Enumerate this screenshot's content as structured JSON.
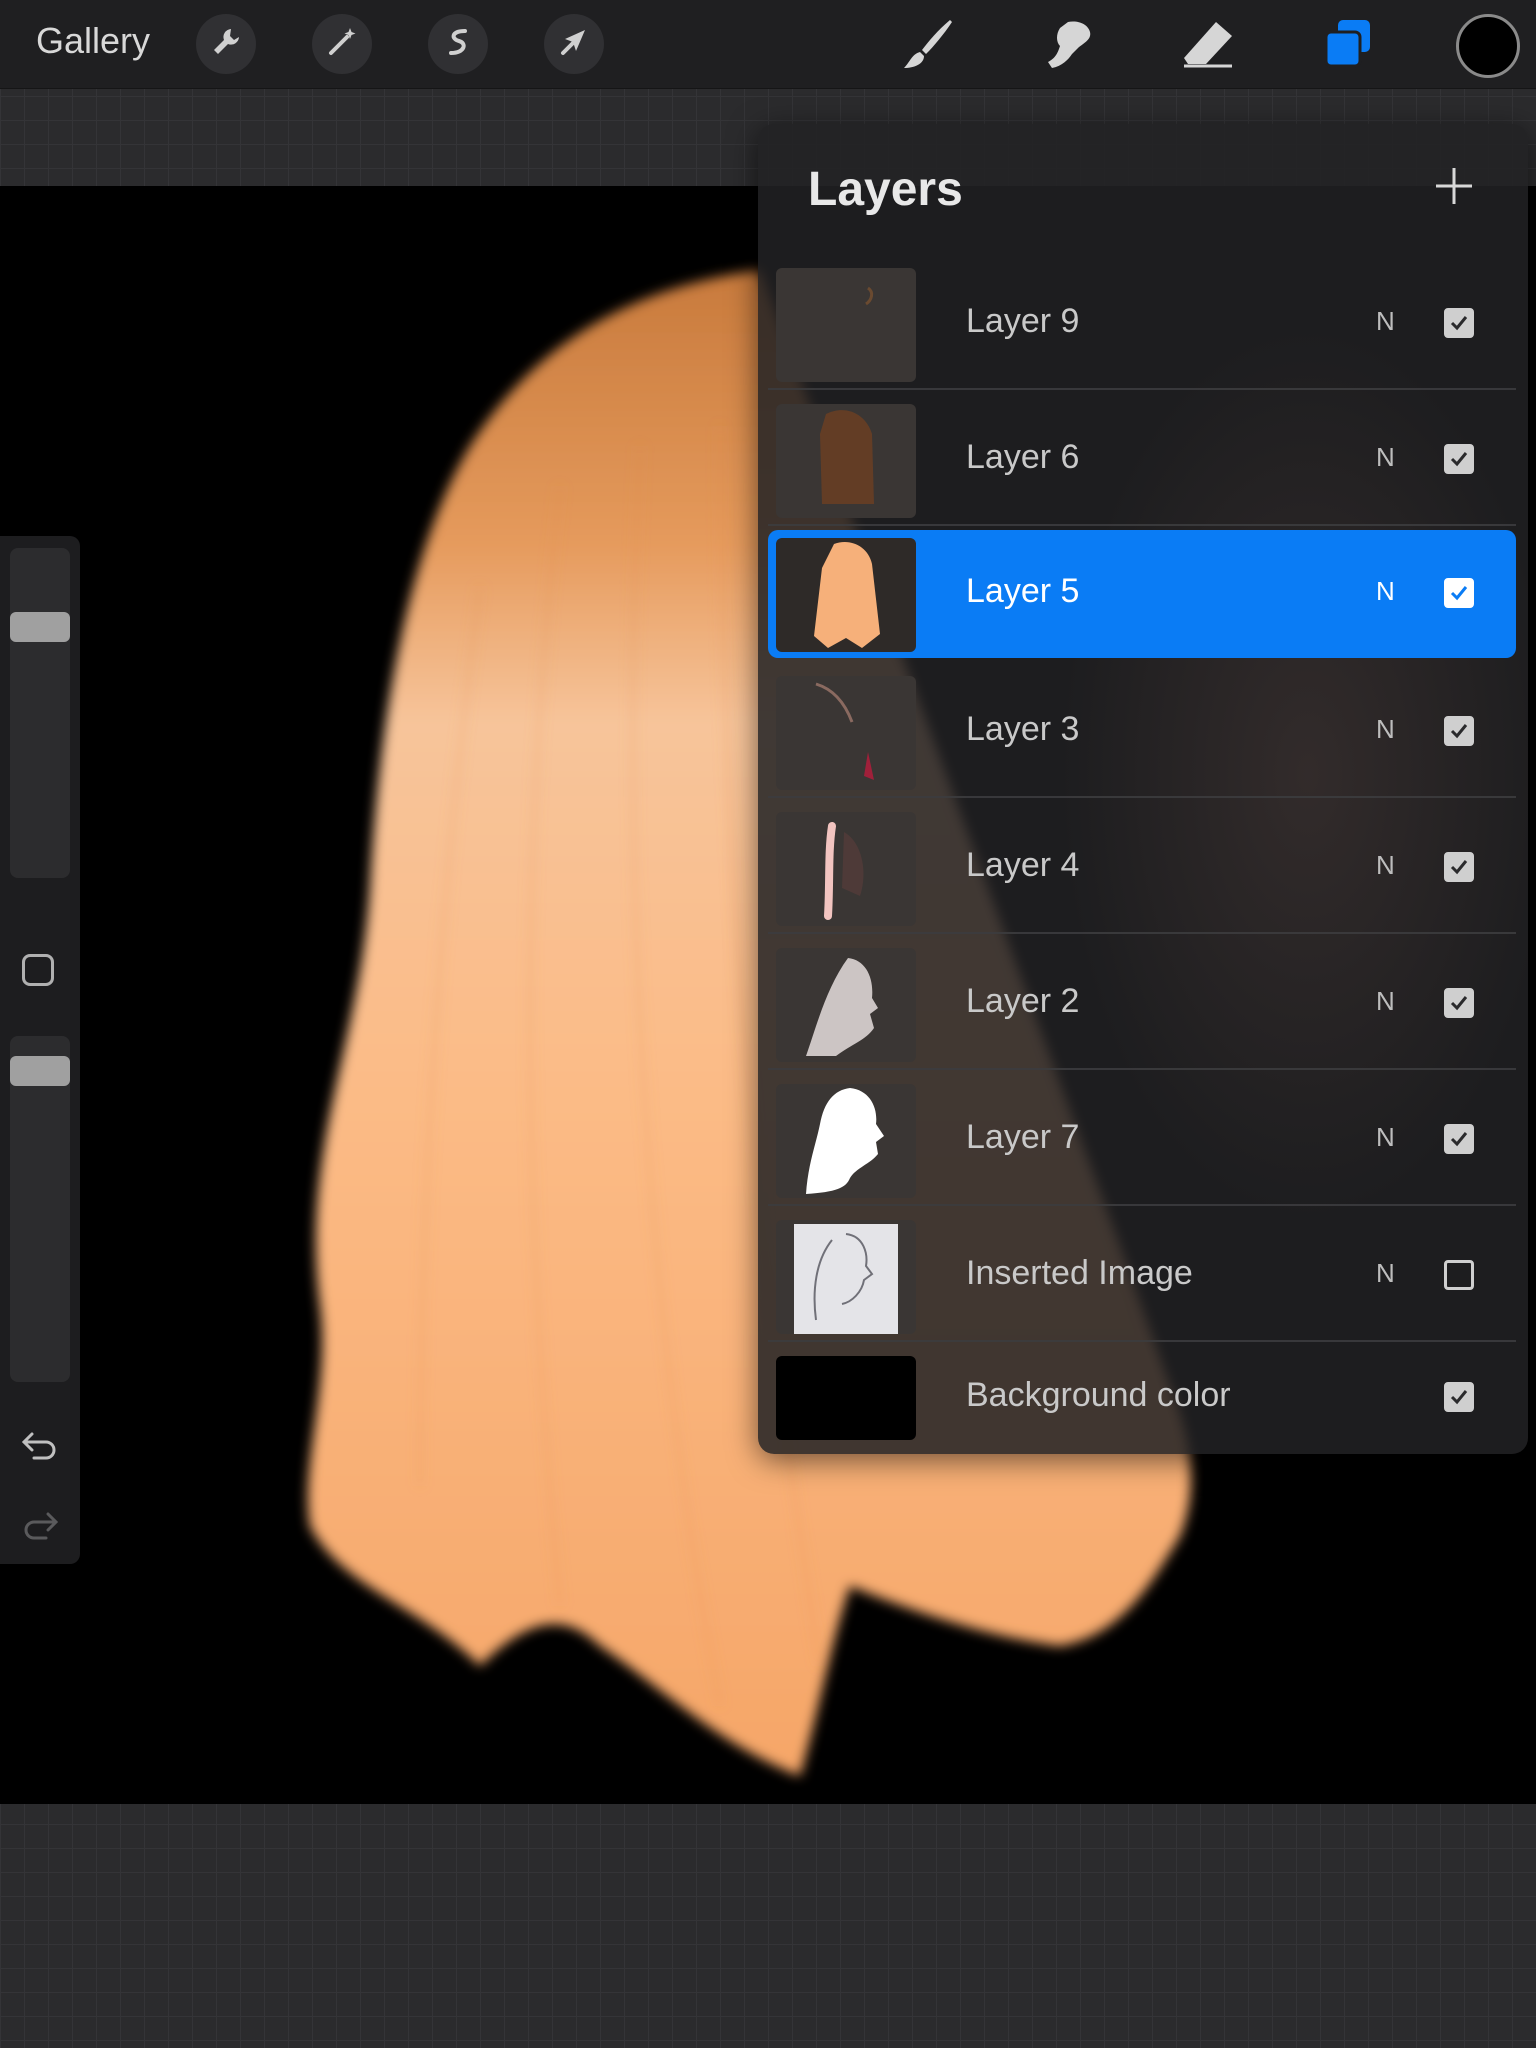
{
  "toolbar": {
    "gallery_label": "Gallery",
    "left_tools": [
      "wrench-icon",
      "magic-wand-icon",
      "selection-icon",
      "transform-arrow-icon"
    ],
    "right_tools": [
      "brush-icon",
      "smudge-icon",
      "eraser-icon",
      "layers-icon"
    ],
    "accent_color": "#0a7cf5",
    "current_color": "#000000"
  },
  "layers": {
    "title": "Layers",
    "items": [
      {
        "name": "Layer 9",
        "blend": "N",
        "visible": true,
        "selected": false
      },
      {
        "name": "Layer 6",
        "blend": "N",
        "visible": true,
        "selected": false
      },
      {
        "name": "Layer 5",
        "blend": "N",
        "visible": true,
        "selected": true
      },
      {
        "name": "Layer 3",
        "blend": "N",
        "visible": true,
        "selected": false
      },
      {
        "name": "Layer 4",
        "blend": "N",
        "visible": true,
        "selected": false
      },
      {
        "name": "Layer 2",
        "blend": "N",
        "visible": true,
        "selected": false
      },
      {
        "name": "Layer 7",
        "blend": "N",
        "visible": true,
        "selected": false
      },
      {
        "name": "Inserted Image",
        "blend": "N",
        "visible": false,
        "selected": false
      },
      {
        "name": "Background color",
        "blend": "",
        "visible": true,
        "selected": false
      }
    ]
  },
  "sidebar": {
    "brush_size_label": "",
    "opacity_label": ""
  }
}
